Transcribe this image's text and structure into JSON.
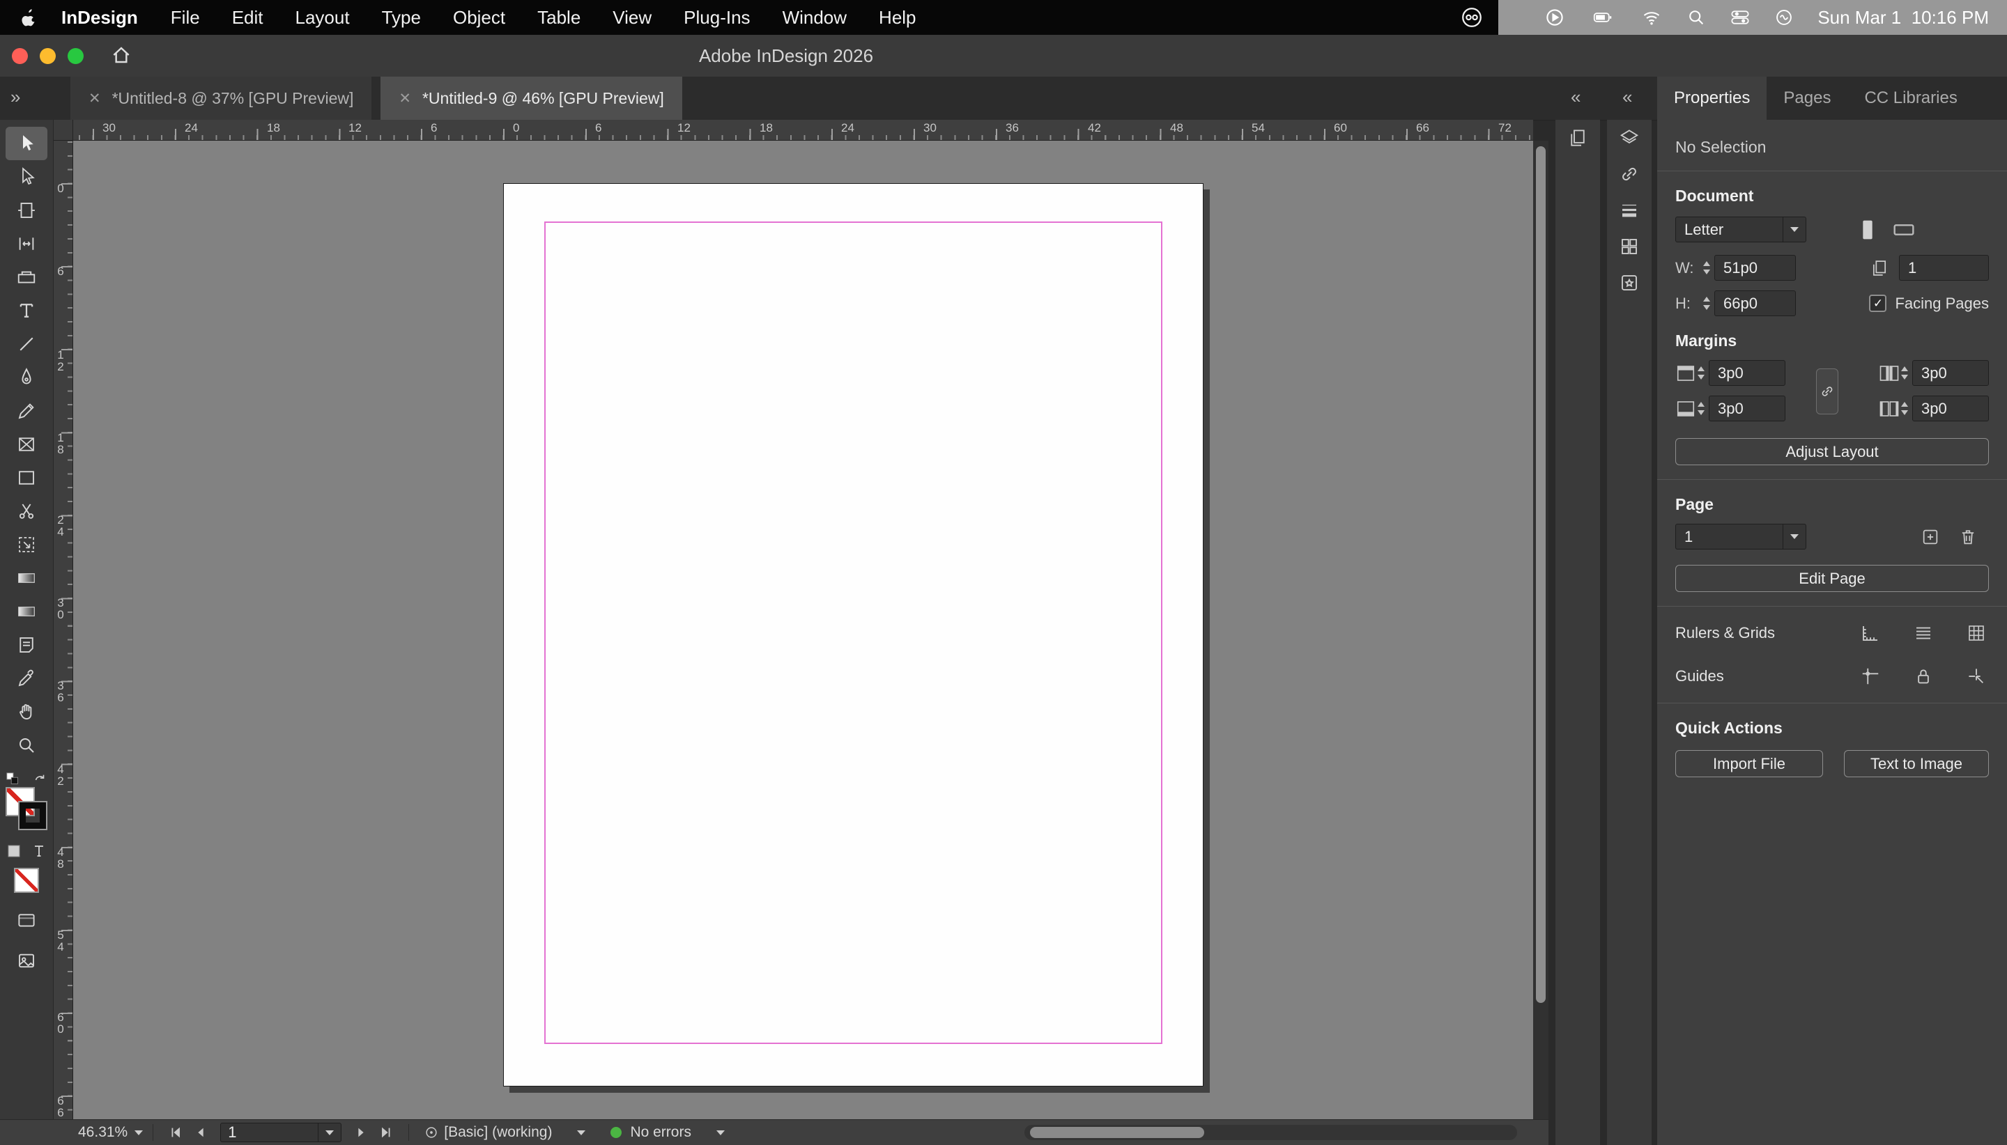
{
  "icons": {
    "close": "✕",
    "overflow_left": "»",
    "dock_collapse": "«",
    "panel_collapse": "»",
    "check": "✓"
  },
  "menubar": {
    "app_name": "InDesign",
    "menus": [
      "File",
      "Edit",
      "Layout",
      "Type",
      "Object",
      "Table",
      "View",
      "Plug-Ins",
      "Window",
      "Help"
    ],
    "clock": "Sun Mar 1  10:16 PM"
  },
  "titlebar": {
    "title": "Adobe InDesign 2026"
  },
  "tabs": [
    {
      "label": "*Untitled-8 @ 37% [GPU Preview]"
    },
    {
      "label": "*Untitled-9 @ 46% [GPU Preview]"
    }
  ],
  "toolbar_tools": [
    "Selection",
    "Direct Selection",
    "Page",
    "Gap",
    "Content Collector",
    "Type",
    "Line",
    "Pen",
    "Pencil",
    "Rectangle Frame",
    "Rectangle",
    "Scissors",
    "Free Transform",
    "Gradient Swatch",
    "Gradient Feather",
    "Note",
    "Eyedropper",
    "Hand",
    "Zoom"
  ],
  "rulers": {
    "horizontal": [
      "30",
      "24",
      "18",
      "12",
      "6",
      "0",
      "6",
      "12",
      "18",
      "24",
      "30",
      "36",
      "42",
      "48",
      "54",
      "60",
      "66",
      "72"
    ],
    "vertical": [
      "0",
      "6",
      "12",
      "18",
      "24",
      "30",
      "36",
      "42",
      "48",
      "54",
      "60",
      "66"
    ]
  },
  "panel": {
    "tabs": [
      "Properties",
      "Pages",
      "CC Libraries"
    ],
    "no_selection": "No Selection",
    "document": {
      "header": "Document",
      "page_size": "Letter",
      "w_label": "W:",
      "w_value": "51p0",
      "h_label": "H:",
      "h_value": "66p0",
      "pages_count": "1",
      "facing_pages_label": "Facing Pages"
    },
    "margins": {
      "header": "Margins",
      "top": "3p0",
      "bottom": "3p0",
      "inside": "3p0",
      "outside": "3p0"
    },
    "adjust_layout": "Adjust Layout",
    "page": {
      "header": "Page",
      "current": "1",
      "edit_page": "Edit Page"
    },
    "rulers_grids_label": "Rulers & Grids",
    "guides_label": "Guides",
    "quick_actions": {
      "header": "Quick Actions",
      "import_file": "Import File",
      "text_to_image": "Text to Image"
    }
  },
  "statusbar": {
    "zoom": "46.31%",
    "page": "1",
    "preflight_profile": "[Basic] (working)",
    "preflight_status": "No errors"
  },
  "colors": {
    "margin_guide": "#e472d2",
    "preflight_ok": "#4bb543",
    "traffic_red": "#ff5f57",
    "traffic_yellow": "#febc2e",
    "traffic_green": "#28c840"
  }
}
